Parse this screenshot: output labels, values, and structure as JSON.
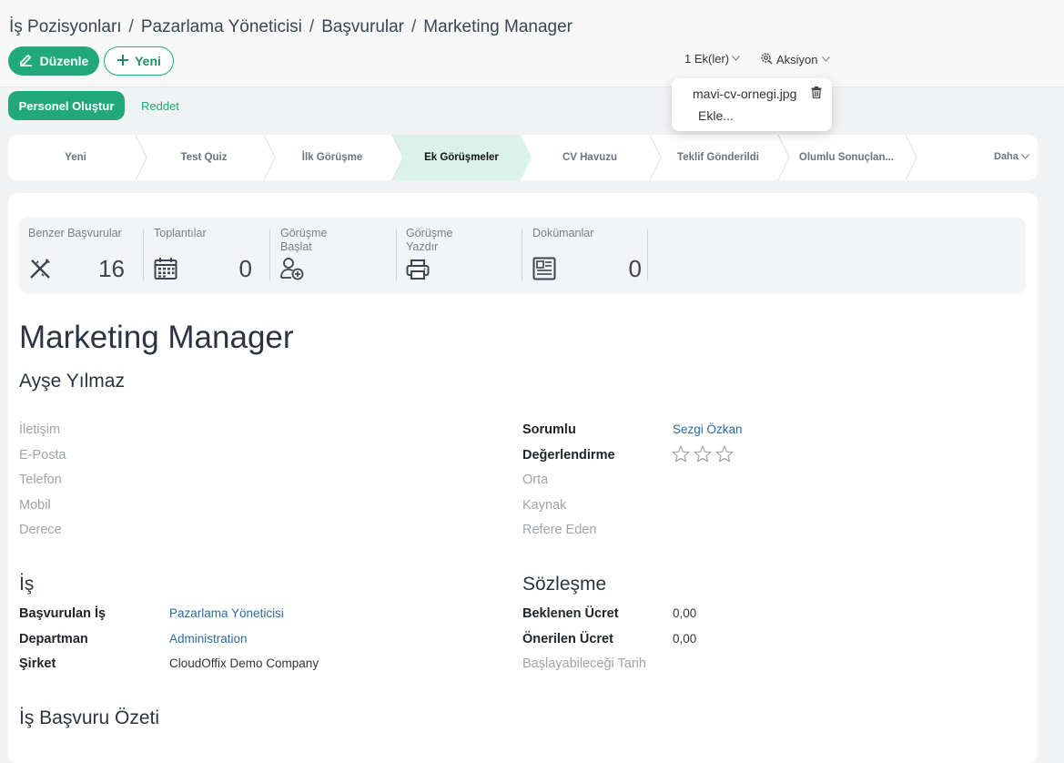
{
  "breadcrumb": {
    "items": [
      "İş Pozisyonları",
      "Pazarlama Yöneticisi",
      "Başvurular",
      "Marketing Manager"
    ],
    "separator": "/"
  },
  "toolbar": {
    "edit_label": "Düzenle",
    "new_label": "Yeni",
    "attachments_label": "1 Ek(ler)",
    "actions_label": "Aksiyon"
  },
  "attachment_dropdown": {
    "file_name": "mavi-cv-ornegi.jpg",
    "add_label": "Ekle..."
  },
  "header_buttons": {
    "create_employee": "Personel Oluştur",
    "refuse": "Reddet"
  },
  "stages": {
    "items": [
      "Yeni",
      "Test Quiz",
      "İlk Görüşme",
      "Ek Görüşmeler",
      "CV Havuzu",
      "Teklif Gönderildi",
      "Olumlu Sonuçlan..."
    ],
    "active_index": 3,
    "more_label": "Daha"
  },
  "smart_buttons": {
    "similar": {
      "label": "Benzer Başvurular",
      "value": "16",
      "icon": "pencil-ruler-icon"
    },
    "meetings": {
      "label": "Toplantılar",
      "value": "0",
      "icon": "calendar-icon"
    },
    "start_interview": {
      "label_line1": "Görüşme",
      "label_line2": "Başlat",
      "icon": "user-add-icon"
    },
    "print_interview": {
      "label_line1": "Görüşme",
      "label_line2": "Yazdır",
      "icon": "printer-icon"
    },
    "documents": {
      "label": "Dokümanlar",
      "value": "0",
      "icon": "document-icon"
    }
  },
  "record": {
    "title": "Marketing Manager",
    "applicant_name": "Ayşe Yılmaz"
  },
  "contact": {
    "contact_label": "İletişim",
    "email_label": "E-Posta",
    "phone_label": "Telefon",
    "mobile_label": "Mobil",
    "degree_label": "Derece"
  },
  "assignment": {
    "responsible_label": "Sorumlu",
    "responsible_value": "Sezgi Özkan",
    "rating_label": "Değerlendirme",
    "rating_value": 0,
    "rating_max": 3,
    "medium_label": "Orta",
    "source_label": "Kaynak",
    "referrer_label": "Refere Eden"
  },
  "job": {
    "section_title": "İş",
    "applied_job_label": "Başvurulan İş",
    "applied_job_value": "Pazarlama Yöneticisi",
    "department_label": "Departman",
    "department_value": "Administration",
    "company_label": "Şirket",
    "company_value": "CloudOffix Demo Company"
  },
  "contract": {
    "section_title": "Sözleşme",
    "expected_salary_label": "Beklenen Ücret",
    "expected_salary_value": "0,00",
    "proposed_salary_label": "Önerilen Ücret",
    "proposed_salary_value": "0,00",
    "availability_label": "Başlayabileceği Tarih"
  },
  "summary": {
    "section_title": "İş Başvuru Özeti"
  },
  "colors": {
    "primary": "#22a97b",
    "active_stage": "#d9f2ea",
    "link": "#2c6aa8"
  }
}
